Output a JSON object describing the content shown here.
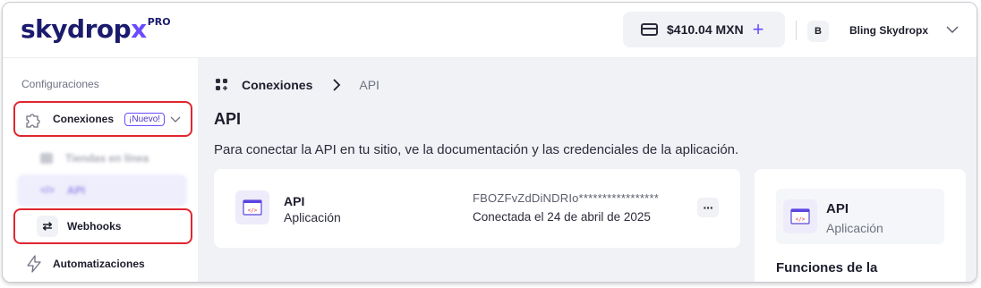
{
  "header": {
    "logo_text": "skydrop",
    "logo_x": "x",
    "logo_tier": "PRO",
    "balance": "$410.04 MXN",
    "add_balance_icon": "plus-icon",
    "avatar_initial": "B",
    "account_name": "Bling Skydropx"
  },
  "sidebar": {
    "heading": "Configuraciones",
    "items": [
      {
        "label": "Conexiones",
        "badge": "¡Nuevo!",
        "icon": "puzzle-icon"
      },
      {
        "label": "Tiendas en línea",
        "icon": "store-icon"
      },
      {
        "label": "API",
        "icon": "code-icon"
      },
      {
        "label": "Webhooks",
        "icon": "arrows-exchange-icon"
      },
      {
        "label": "Automatizaciones",
        "icon": "lightning-icon"
      }
    ]
  },
  "main": {
    "breadcrumb": {
      "root": "Conexiones",
      "current": "API"
    },
    "title": "API",
    "description": "Para conectar la API en tu sitio, ve la documentación y las credenciales de la aplicación.",
    "api_card": {
      "name": "API",
      "type": "Aplicación",
      "key": "FBOZFvZdDiNDRIo*****************",
      "status": "Conectada el 24 de abril de 2025",
      "more": "···"
    },
    "side_card": {
      "name": "API",
      "type": "Aplicación",
      "section_title": "Funciones de la"
    }
  },
  "colors": {
    "accent": "#6a4cff",
    "brand_dark": "#1b1b6e",
    "highlight_border": "#e0262f",
    "main_bg": "#f1f2f6"
  }
}
